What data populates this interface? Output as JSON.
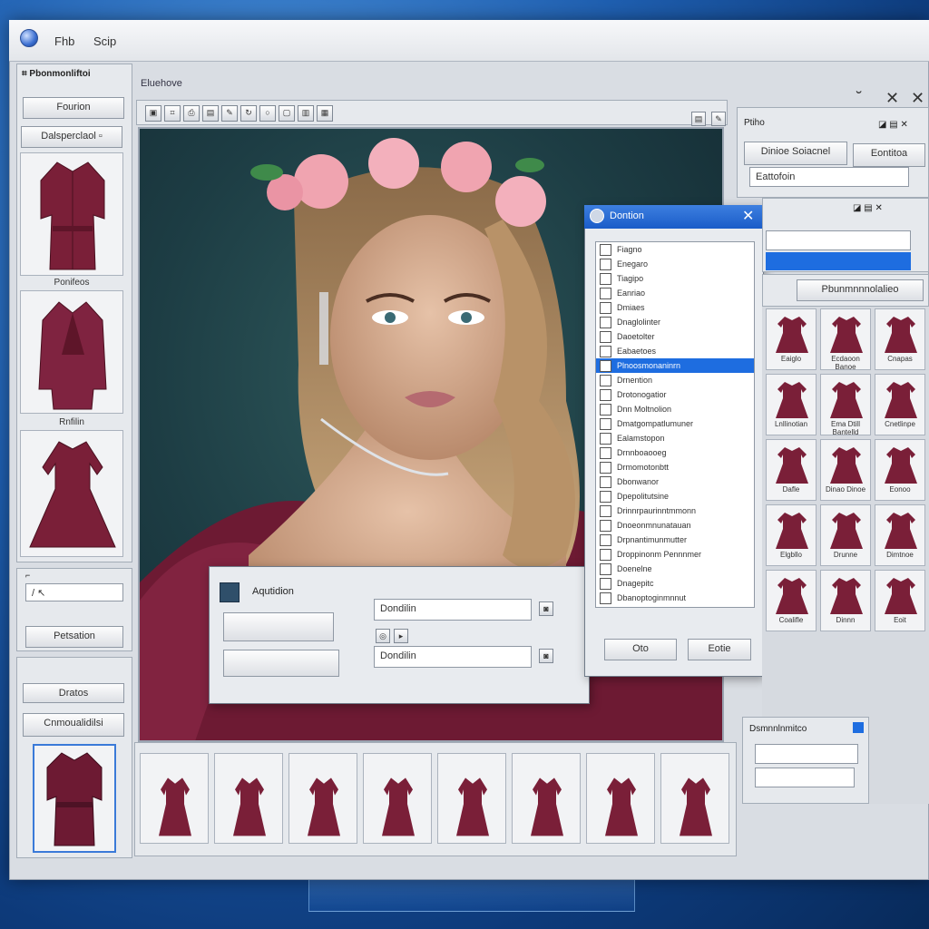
{
  "menu": {
    "items": [
      "Fhb",
      "Scip"
    ]
  },
  "left_panel": {
    "header": "Pbonmonliftoi",
    "button1": "Fourion",
    "button2": "Dalsperclaol",
    "captions": [
      "Ponifeos",
      "Rnfilin"
    ],
    "props_button": "Petsation",
    "lower_button1": "Dratos",
    "lower_button2": "Cnmoualidilsi"
  },
  "center": {
    "title": "Eluehove"
  },
  "adjust_dialog": {
    "title": "Aqutidion",
    "field1": "Dondilin",
    "field2": "Dondilin"
  },
  "list_dialog": {
    "title": "Dontion",
    "items": [
      "Fiagno",
      "Enegaro",
      "Tiagipo",
      "Eanriao",
      "Dmiaes",
      "Dnaglolinter",
      "Daoetolter",
      "Eabaetoes",
      "Plnoosmonaninrn",
      "Drnention",
      "Drotonogatior",
      "Dnn Moltnolion",
      "Dmatgompatlumuner",
      "Ealamstopon",
      "Drnnboaooeg",
      "Drmomotonbtt",
      "Dbonwanor",
      "Dpepolitutsine",
      "Drinnrpaurinntmmonn",
      "Dnoeonmnunatauan",
      "Drpnantimunmutter",
      "Droppinonm Pennnmer",
      "Doenelne",
      "Dnagepitc",
      "Dbanoptoginmnnut"
    ],
    "selected_index": 8,
    "ok_label": "Oto",
    "cancel_label": "Eotie"
  },
  "right_panel": {
    "title": "Ptiho",
    "button1": "Dinioe Soiacnel",
    "button2": "Eontitoa",
    "field": "Eattofoin",
    "section": "Pbunmnnnolalieo",
    "tile_captions": [
      "Eaiglo",
      "Ecdaoon Banoe",
      "Cnapas",
      "Lnllinotian",
      "Ema Dtill Bantelld",
      "Cnetlinpe",
      "Dafle",
      "Dinao Dinoe",
      "Eonoo",
      "Elgbllo",
      "Drunne",
      "Dimtnoe",
      "Coalifle",
      "Dinnn",
      "Eoit"
    ],
    "bottom_title": "Dsmnnlnmitco"
  },
  "filmstrip": {
    "count": 8
  },
  "colors": {
    "accent": "#1e6de0",
    "garment": "#7a1f38"
  },
  "icons": [
    "window-orb-icon",
    "minimize-icon",
    "close-icon",
    "toolbar-icons",
    "garment-icons"
  ]
}
